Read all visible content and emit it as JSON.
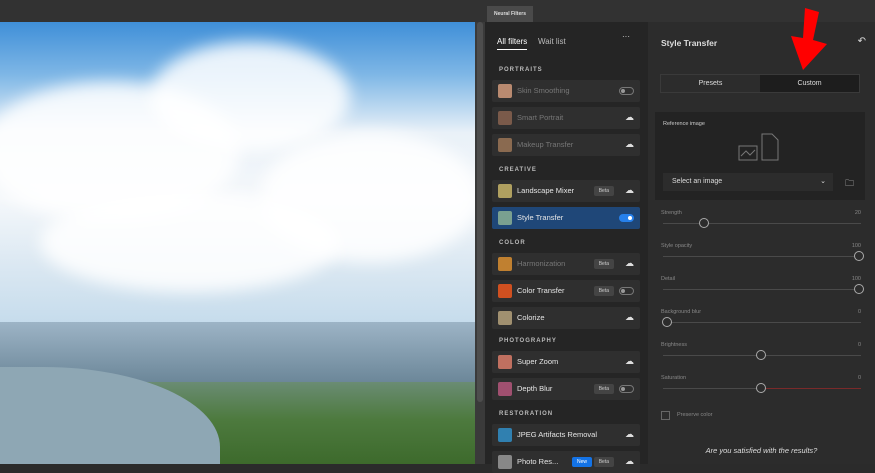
{
  "top": {
    "tab": "Neural Filters"
  },
  "left": {
    "tabs": [
      "All filters",
      "Wait list"
    ],
    "more": "···",
    "sections": [
      {
        "title": "PORTRAITS",
        "items": [
          {
            "label": "Skin Smoothing",
            "state": "toggle-off",
            "disabled": true,
            "color": "#b98a70"
          },
          {
            "label": "Smart Portrait",
            "state": "cloud",
            "disabled": true,
            "color": "#7a5a4a"
          },
          {
            "label": "Makeup Transfer",
            "state": "cloud",
            "disabled": true,
            "color": "#8a6a50"
          }
        ]
      },
      {
        "title": "CREATIVE",
        "items": [
          {
            "label": "Landscape Mixer",
            "badge": "Beta",
            "state": "cloud",
            "color": "#b0a060"
          },
          {
            "label": "Style Transfer",
            "state": "toggle-on",
            "selected": true,
            "color": "#7aa090"
          }
        ]
      },
      {
        "title": "COLOR",
        "items": [
          {
            "label": "Harmonization",
            "badge": "Beta",
            "state": "cloud",
            "disabled": true,
            "color": "#c08030"
          },
          {
            "label": "Color Transfer",
            "badge": "Beta",
            "state": "toggle-off",
            "color": "#d05020"
          },
          {
            "label": "Colorize",
            "state": "cloud",
            "color": "#a09070"
          }
        ]
      },
      {
        "title": "PHOTOGRAPHY",
        "items": [
          {
            "label": "Super Zoom",
            "state": "cloud",
            "color": "#c07060"
          },
          {
            "label": "Depth Blur",
            "badge": "Beta",
            "state": "toggle-off",
            "color": "#a05070"
          }
        ]
      },
      {
        "title": "RESTORATION",
        "items": [
          {
            "label": "JPEG Artifacts Removal",
            "state": "cloud",
            "color": "#3080b0"
          },
          {
            "label": "Photo Res...",
            "badge_new": "New",
            "badge": "Beta",
            "state": "cloud",
            "color": "#888888"
          }
        ]
      }
    ]
  },
  "right": {
    "title": "Style Transfer",
    "segments": [
      "Presets",
      "Custom"
    ],
    "active_segment": "Custom",
    "reference_label": "Reference image",
    "select_value": "Select an image",
    "sliders": [
      {
        "label": "Strength",
        "value": "20",
        "fraction": 0.21
      },
      {
        "label": "Style opacity",
        "value": "100",
        "fraction": 1
      },
      {
        "label": "Detail",
        "value": "100",
        "fraction": 1
      },
      {
        "label": "Background blur",
        "value": "0",
        "fraction": 0.02
      },
      {
        "label": "Brightness",
        "value": "0",
        "fraction": 0.5
      },
      {
        "label": "Saturation",
        "value": "0",
        "fraction": 0.5
      }
    ],
    "preserve_color": "Preserve color",
    "question": "Are you satisfied with the results?"
  },
  "colors": {
    "accent": "#2680eb",
    "arrow": "#ff0000",
    "selected_row": "#1f4778"
  }
}
